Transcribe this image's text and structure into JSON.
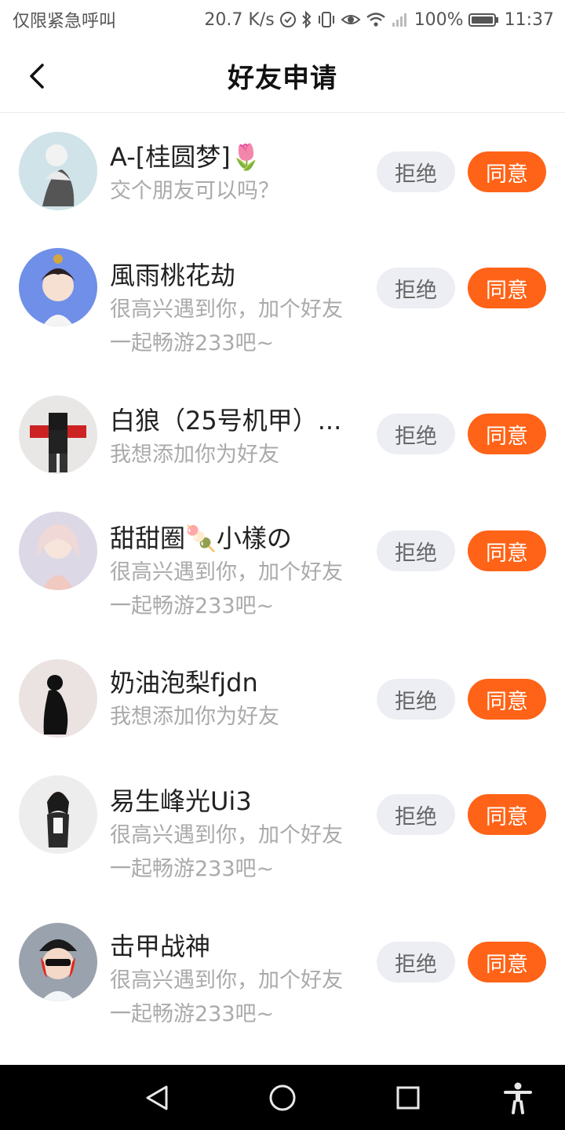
{
  "status_bar": {
    "carrier": "仅限紧急呼叫",
    "speed": "20.7 K/s",
    "battery": "100%",
    "time": "11:37",
    "icons": [
      "data-saver-icon",
      "bluetooth-icon",
      "vibrate-icon",
      "eye-comfort-icon",
      "wifi-icon",
      "signal-icon",
      "battery-icon"
    ]
  },
  "header": {
    "title": "好友申请",
    "back_icon": "back-arrow-icon"
  },
  "requests": [
    {
      "nickname": "A-[桂圆梦]🌷",
      "message": "交个朋友可以吗？",
      "avatar_bg": "#cfe3e8",
      "reject": "拒绝",
      "accept": "同意"
    },
    {
      "nickname": "風雨桃花劫",
      "message": "很高兴遇到你，加个好友一起畅游233吧~",
      "avatar_bg": "#6f8fe8",
      "reject": "拒绝",
      "accept": "同意"
    },
    {
      "nickname": "白狼（25号机甲）...",
      "message": "我想添加你为好友",
      "avatar_bg": "#e9e6e6",
      "reject": "拒绝",
      "accept": "同意"
    },
    {
      "nickname": "甜甜圈🍡小樣の",
      "message": "很高兴遇到你，加个好友一起畅游233吧~",
      "avatar_bg": "#dcd8e6",
      "reject": "拒绝",
      "accept": "同意"
    },
    {
      "nickname": "奶油泡梨fjdn",
      "message": "我想添加你为好友",
      "avatar_bg": "#ebe3e1",
      "reject": "拒绝",
      "accept": "同意"
    },
    {
      "nickname": "易生峰光Ui3",
      "message": "很高兴遇到你，加个好友一起畅游233吧~",
      "avatar_bg": "#ededed",
      "reject": "拒绝",
      "accept": "同意"
    },
    {
      "nickname": "击甲战神",
      "message": "很高兴遇到你，加个好友一起畅游233吧~",
      "avatar_bg": "#9aa3ad",
      "reject": "拒绝",
      "accept": "同意"
    }
  ],
  "colors": {
    "accent": "#ff6317",
    "reject_bg": "#eceef3",
    "message_text": "#aaaaaa"
  },
  "nav_bar": {
    "icons": [
      "back-triangle-icon",
      "home-circle-icon",
      "recents-square-icon",
      "accessibility-icon"
    ]
  }
}
